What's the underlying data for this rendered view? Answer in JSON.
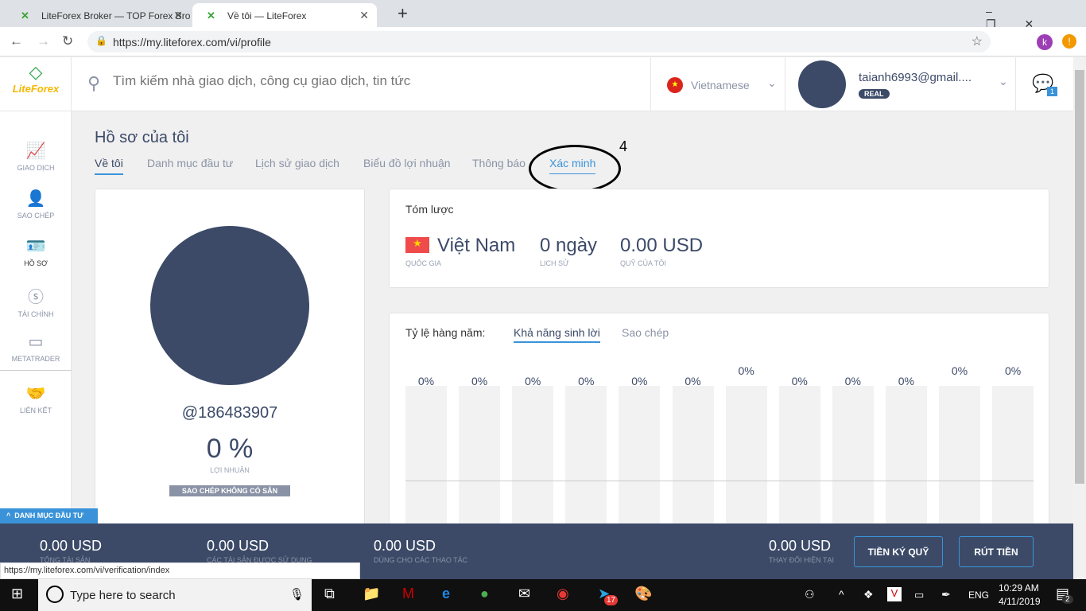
{
  "browser": {
    "tabs": [
      {
        "title": "LiteForex Broker — TOP Forex Bro",
        "active": false
      },
      {
        "title": "Về tôi — LiteForex",
        "active": true
      }
    ],
    "url": "https://my.liteforex.com/vi/profile",
    "status_url": "https://my.liteforex.com/vi/verification/index",
    "profile_initial": "k"
  },
  "logo": "LiteForex",
  "sidebar": {
    "items": [
      {
        "label": "GIAO DỊCH",
        "icon": "chart-icon"
      },
      {
        "label": "SAO CHÉP",
        "icon": "user-icon"
      },
      {
        "label": "HỒ SƠ",
        "icon": "id-card-icon",
        "active": true
      },
      {
        "label": "TÀI CHÍNH",
        "icon": "dollar-icon"
      },
      {
        "label": "METATRADER",
        "icon": "window-icon"
      },
      {
        "label": "LIÊN KẾT",
        "icon": "handshake-icon"
      }
    ]
  },
  "search": {
    "placeholder": "Tìm kiếm nhà giao dịch, công cụ giao dịch, tin tức"
  },
  "language": "Vietnamese",
  "user": {
    "email": "taianh6993@gmail....",
    "badge": "REAL",
    "notifications": "1"
  },
  "page": {
    "title": "Hồ sơ của tôi",
    "tabs": [
      "Về tôi",
      "Danh mục đầu tư",
      "Lịch sử giao dịch",
      "Biểu đồ lợi nhuận",
      "Thông báo",
      "Xác minh"
    ],
    "active_tab": 0,
    "annotation": "4"
  },
  "profile": {
    "username": "@186483907",
    "profit": "0 %",
    "profit_label": "LỢI NHUẬN",
    "copy_badge": "SAO CHÉP KHÔNG CÓ SẴN"
  },
  "summary": {
    "title": "Tóm lược",
    "country": "Việt Nam",
    "country_label": "QUỐC GIA",
    "history": "0 ngày",
    "history_label": "LỊCH SỬ",
    "fund": "0.00 USD",
    "fund_label": "QUỸ CỦA TÔI"
  },
  "annual": {
    "label": "Tỷ lệ hàng năm:",
    "tabs": [
      "Khả năng sinh lời",
      "Sao chép"
    ],
    "active_tab": 0
  },
  "chart_data": {
    "type": "bar",
    "categories": [
      "",
      "",
      "",
      "",
      "",
      "",
      "",
      "",
      "",
      "",
      "",
      ""
    ],
    "values": [
      0,
      0,
      0,
      0,
      0,
      0,
      0,
      0,
      0,
      0,
      0,
      0
    ],
    "data_labels": [
      "0%",
      "0%",
      "0%",
      "0%",
      "0%",
      "0%",
      "0%",
      "0%",
      "0%",
      "0%",
      "0%",
      "0%"
    ]
  },
  "portfolio_toggle": "DANH MỤC ĐẦU TƯ",
  "footer": {
    "stats": [
      {
        "value": "0.00 USD",
        "label": "TỔNG TÀI SẢN"
      },
      {
        "value": "0.00 USD",
        "label": "CÁC TÀI SẢN ĐƯỢC SỬ DỤNG"
      },
      {
        "value": "0.00 USD",
        "label": "DÙNG CHO CÁC THAO TÁC"
      },
      {
        "value": "0.00 USD",
        "label": "THAY ĐỔI HIỆN TẠI"
      }
    ],
    "deposit": "TIỀN KÝ QUỸ",
    "withdraw": "RÚT TIỀN"
  },
  "taskbar": {
    "search_placeholder": "Type here to search",
    "time": "10:29 AM",
    "date": "4/11/2019",
    "lang": "ENG",
    "telegram_badge": "17",
    "notif_badge": "2"
  },
  "colors": {
    "accent": "#3a93d9",
    "navy": "#3c4a68"
  }
}
